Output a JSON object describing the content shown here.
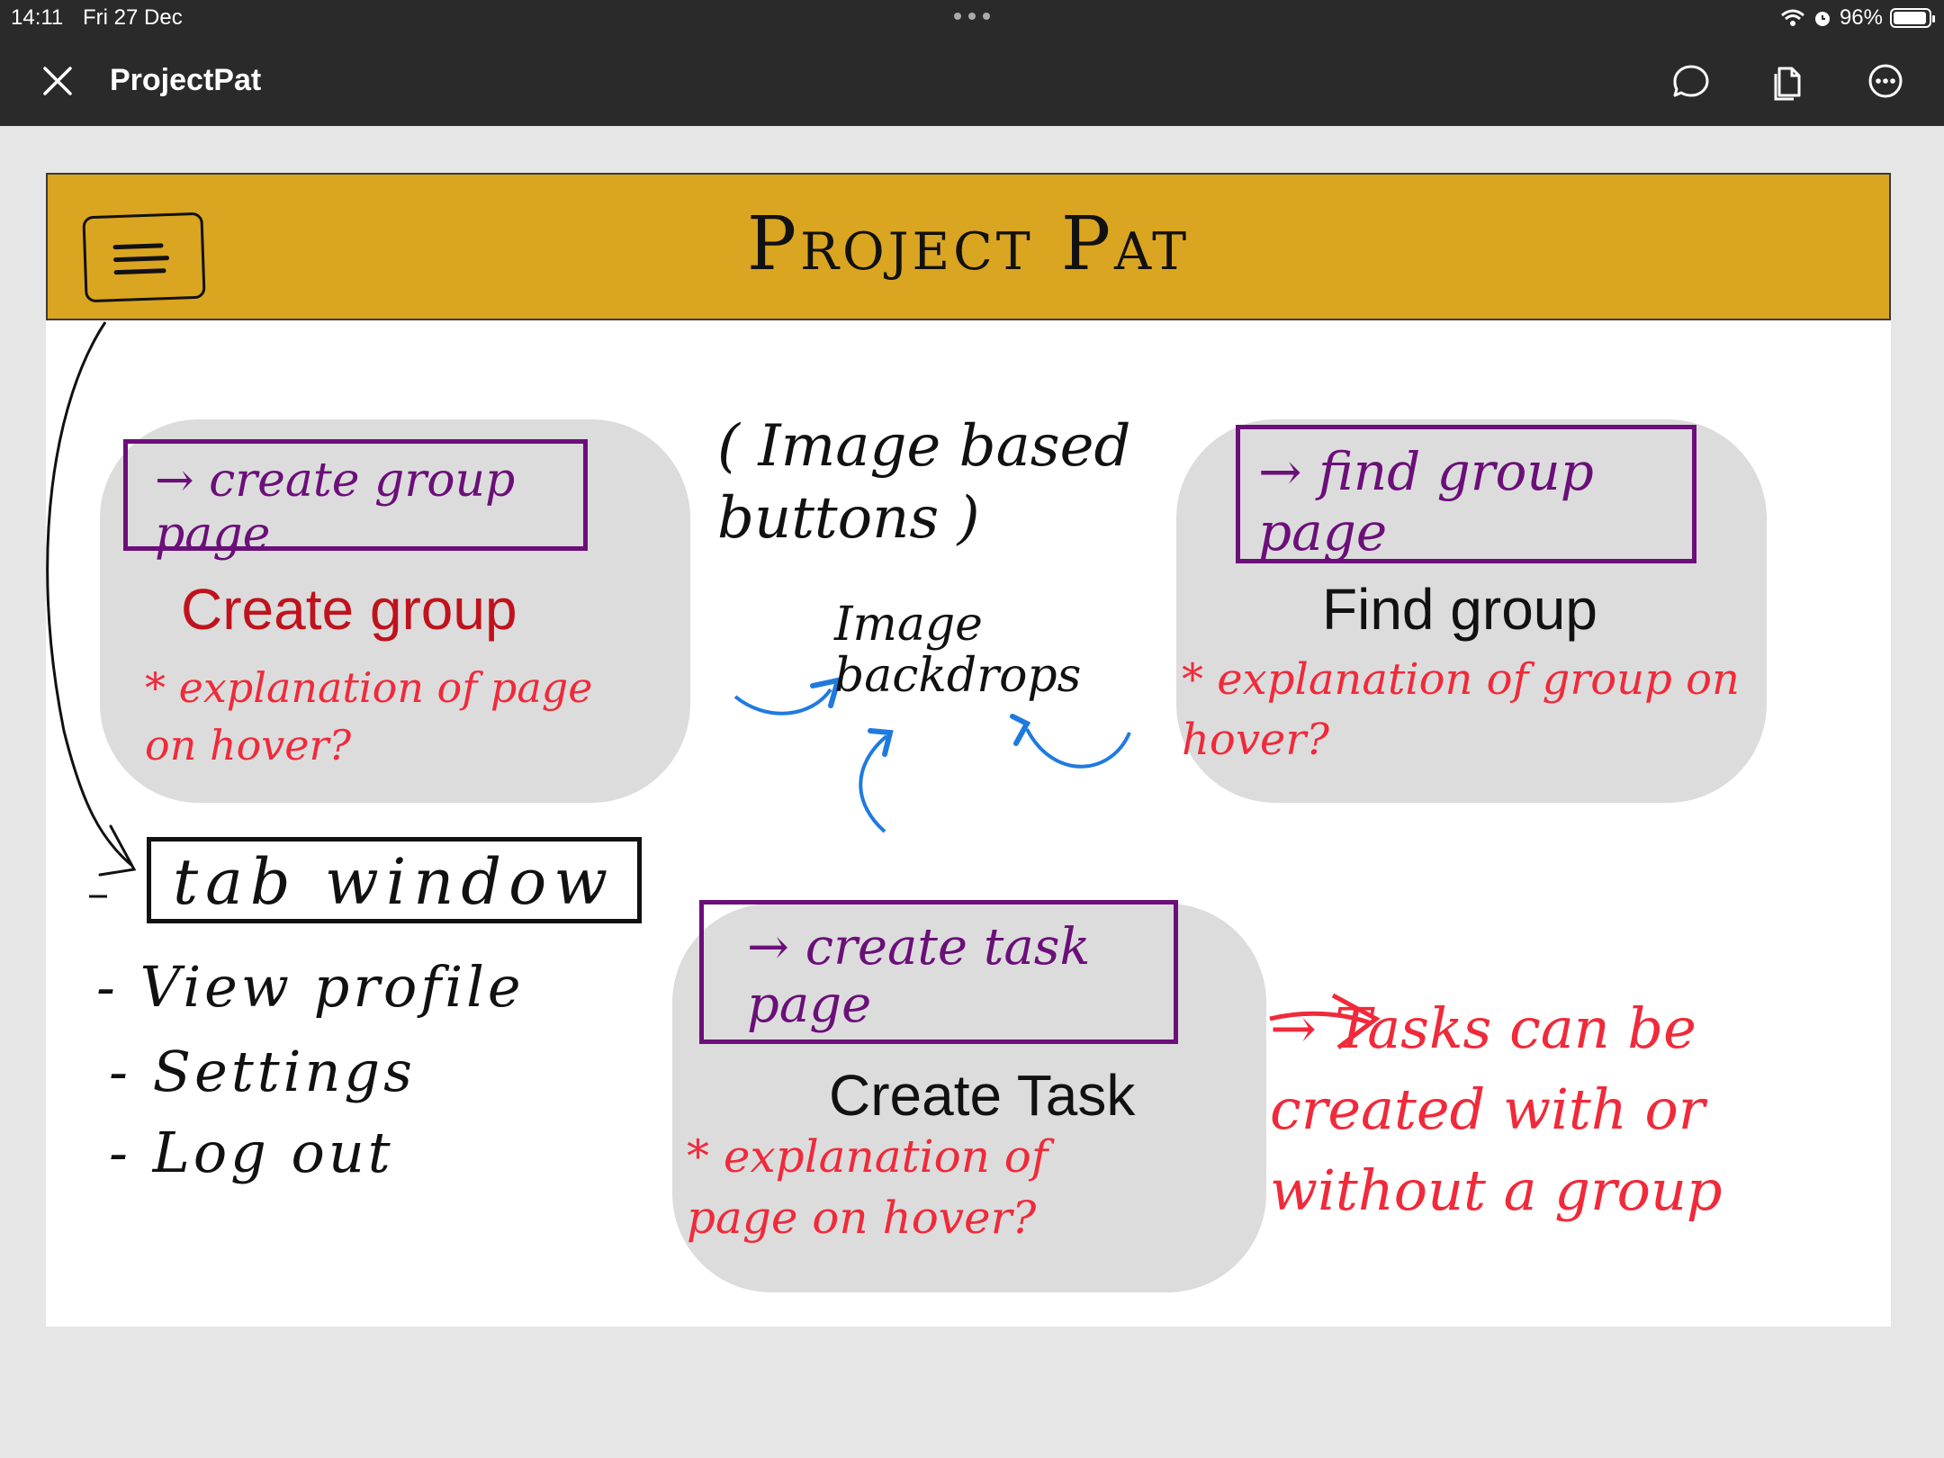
{
  "status_bar": {
    "time": "14:11",
    "date": "Fri 27 Dec",
    "battery": "96%"
  },
  "app": {
    "title": "ProjectPat",
    "icons": [
      "close-icon",
      "comment-icon",
      "pages-icon",
      "more-icon"
    ]
  },
  "sketch": {
    "banner_title": "Project Pat",
    "image_based_note": "( Image based buttons )",
    "image_backdrops_note": "Image backdrops",
    "create_group": {
      "link": "→ create group page",
      "title": "Create group",
      "note": "* explanation of page on hover?"
    },
    "find_group": {
      "link": "→ find group page",
      "title": "Find group",
      "note": "* explanation of group on hover?"
    },
    "create_task": {
      "link": "→ create task page",
      "title": "Create Task",
      "note": "* explanation of page on hover?"
    },
    "tab_window": {
      "label": "tab window",
      "items": [
        "- View profile",
        "- Settings",
        "- Log out"
      ]
    },
    "tasks_note": "→ Tasks can be created with or without a group"
  },
  "colors": {
    "banner": "#daa520",
    "ink_purple": "#6b0f79",
    "ink_red": "#f02a3a",
    "ink_blue": "#1f7ae0",
    "card": "#dcdcdc",
    "create_group_title": "#c0121c"
  }
}
